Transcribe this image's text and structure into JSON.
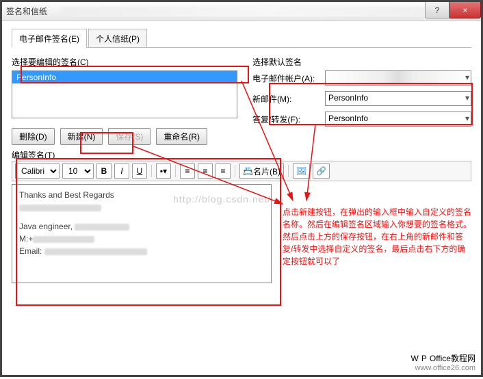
{
  "window": {
    "title": "签名和信纸",
    "help": "?",
    "close": "×"
  },
  "tabs": {
    "active": "电子邮件签名(E)",
    "inactive": "个人信纸(P)"
  },
  "left": {
    "label": "选择要编辑的签名(C)",
    "selected_item": "PersonInfo",
    "buttons": {
      "delete": "删除(D)",
      "new": "新建(N)",
      "save": "保存(S)",
      "rename": "重命名(R)"
    }
  },
  "right": {
    "label": "选择默认签名",
    "account_label": "电子邮件帐户(A):",
    "new_label": "新邮件(M):",
    "new_value": "PersonInfo",
    "reply_label": "答复/转发(F):",
    "reply_value": "PersonInfo"
  },
  "editor": {
    "label": "编辑签名(T)",
    "font": "Calibri",
    "size": "10",
    "card_btn": "名片(B)",
    "body_line1": "Thanks and Best Regards",
    "body_line2": "Java engineer,",
    "body_line3": "M:+",
    "body_line4": "Email:"
  },
  "watermark": "http://blog.csdn.net/",
  "annotation": "点击新建按钮，在弹出的输入框中输入自定义的签名名称。然后在编辑签名区域输入你想要的签名格式。然后点击上方的保存按钮，在右上角的新邮件和答复/转发中选择自定义的签名，最后点击右下方的确定按钮就可以了",
  "footer": {
    "brand1": "Office",
    "brand2": "教程网",
    "url": "www.office26.com"
  }
}
